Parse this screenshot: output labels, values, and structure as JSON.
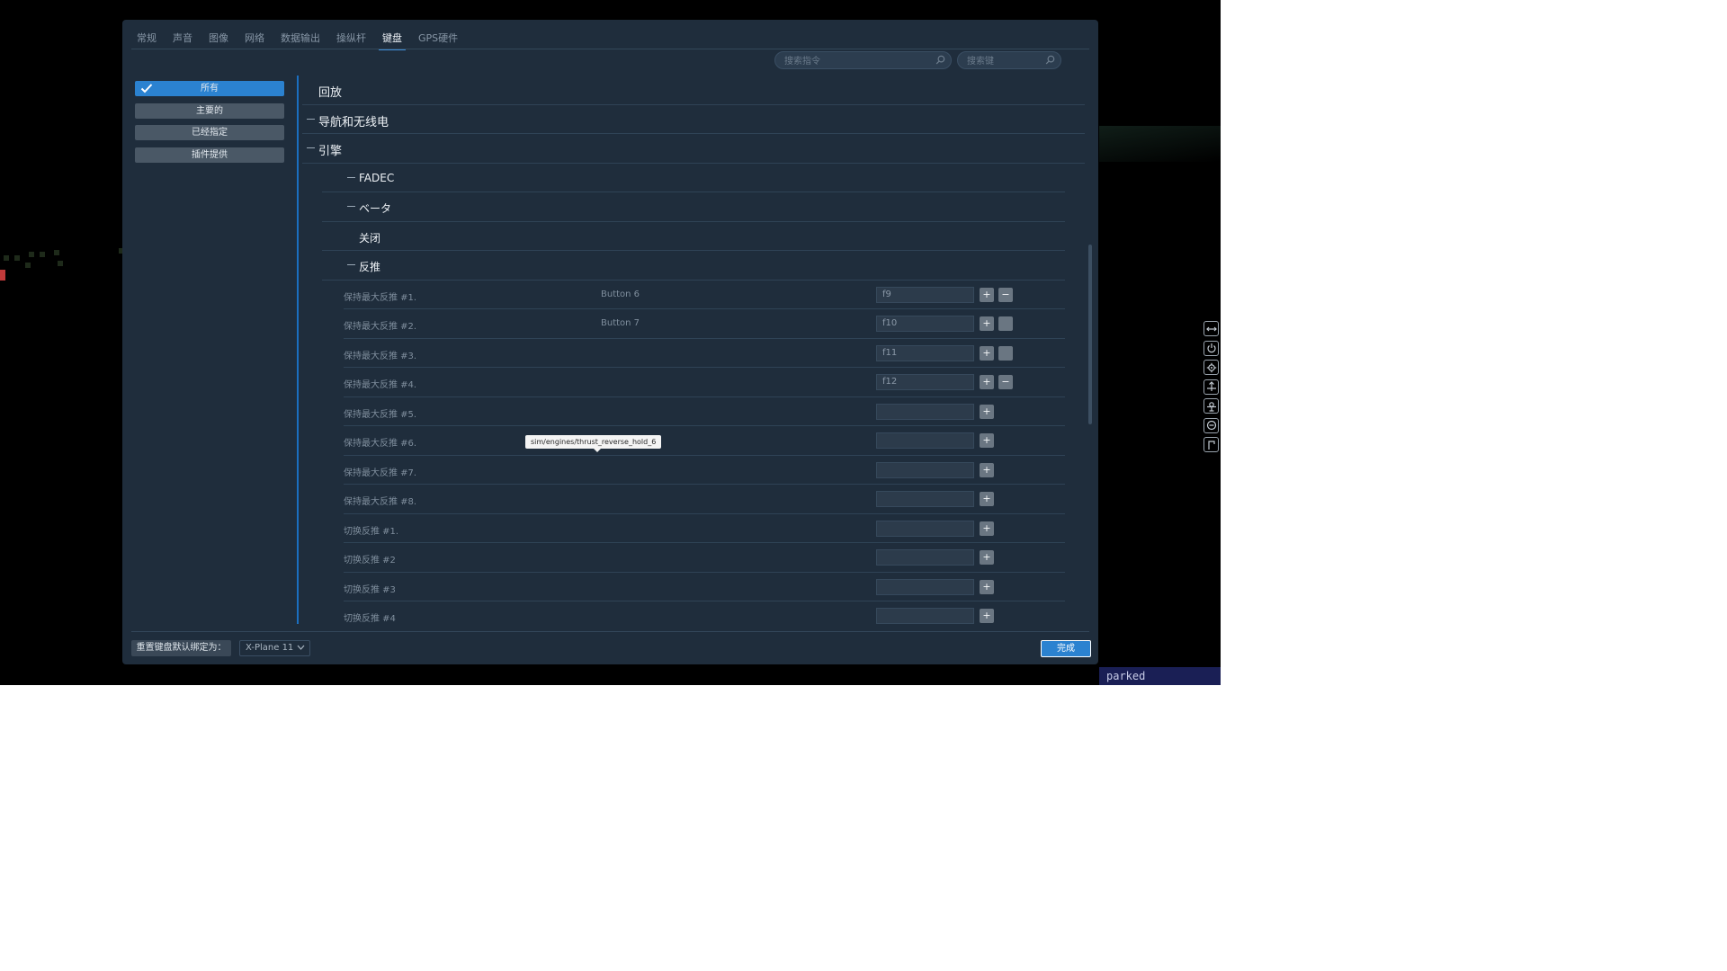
{
  "tabs": [
    {
      "label": "常规",
      "active": false
    },
    {
      "label": "声音",
      "active": false
    },
    {
      "label": "图像",
      "active": false
    },
    {
      "label": "网络",
      "active": false
    },
    {
      "label": "数据输出",
      "active": false
    },
    {
      "label": "操纵杆",
      "active": false
    },
    {
      "label": "键盘",
      "active": true
    },
    {
      "label": "GPS硬件",
      "active": false
    }
  ],
  "search": {
    "command_placeholder": "搜索指令",
    "key_placeholder": "搜索键"
  },
  "sidebar": {
    "items": [
      {
        "label": "所有",
        "active": true
      },
      {
        "label": "主要的",
        "active": false
      },
      {
        "label": "已经指定",
        "active": false
      },
      {
        "label": "插件提供",
        "active": false
      }
    ]
  },
  "tree": {
    "groups": [
      {
        "label": "回放",
        "collapsible": false
      },
      {
        "label": "导航和无线电",
        "collapsible": true
      },
      {
        "label": "引擎",
        "collapsible": true
      }
    ],
    "subgroups": [
      {
        "label": "FADEC",
        "collapsible": true
      },
      {
        "label": "ベータ",
        "collapsible": true
      },
      {
        "label": "关闭",
        "collapsible": false
      },
      {
        "label": "反推",
        "collapsible": true
      }
    ],
    "commands": [
      {
        "name": "保持最大反推 #1.",
        "button": "Button 6",
        "key": "f9",
        "removable": true
      },
      {
        "name": "保持最大反推 #2.",
        "button": "Button 7",
        "key": "f10",
        "removable": true
      },
      {
        "name": "保持最大反推 #3.",
        "button": "",
        "key": "f11",
        "removable": true
      },
      {
        "name": "保持最大反推 #4.",
        "button": "",
        "key": "f12",
        "removable": true
      },
      {
        "name": "保持最大反推 #5.",
        "button": "",
        "key": "",
        "removable": false
      },
      {
        "name": "保持最大反推 #6.",
        "button": "",
        "key": "",
        "removable": false
      },
      {
        "name": "保持最大反推 #7.",
        "button": "",
        "key": "",
        "removable": false
      },
      {
        "name": "保持最大反推 #8.",
        "button": "",
        "key": "",
        "removable": false
      },
      {
        "name": "切换反推 #1.",
        "button": "",
        "key": "",
        "removable": false
      },
      {
        "name": "切换反推 #2",
        "button": "",
        "key": "",
        "removable": false
      },
      {
        "name": "切换反推 #3",
        "button": "",
        "key": "",
        "removable": false
      },
      {
        "name": "切换反推 #4",
        "button": "",
        "key": "",
        "removable": false
      }
    ],
    "plus_symbol": "+",
    "minus_symbol": "−"
  },
  "tooltip": {
    "text": "sim/engines/thrust_reverse_hold_6"
  },
  "footer": {
    "reset_label": "重置键盘默认绑定为：",
    "profile_value": "X-Plane 11",
    "done_label": "完成"
  },
  "status": {
    "text": "parked"
  },
  "colors": {
    "accent": "#2b82d0",
    "dialog_bg": "#1f2d3c",
    "status_bar": "#1a1f55"
  },
  "side_tools": [
    "pan-arrows-icon",
    "power-icon",
    "gear-icon",
    "attitude-icon",
    "aircraft-icon",
    "camera-icon",
    "music-icon"
  ]
}
